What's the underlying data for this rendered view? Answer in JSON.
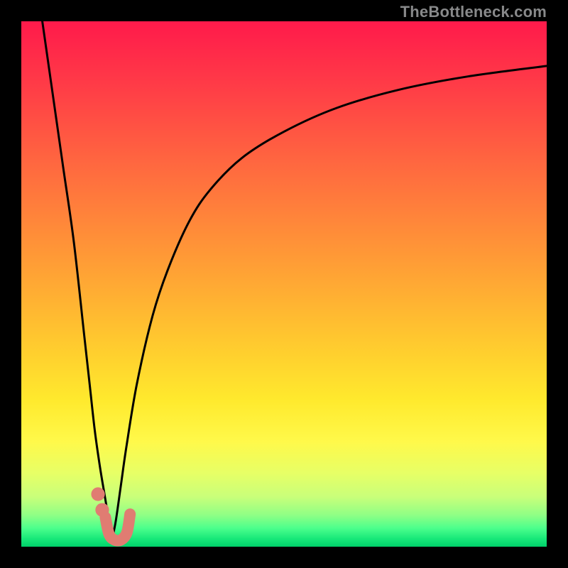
{
  "watermark": "TheBottleneck.com",
  "colors": {
    "black": "#000000",
    "curve": "#000000",
    "marker_fill": "#e07c72",
    "gradient_stops": [
      {
        "offset": 0.0,
        "color": "#ff1a4b"
      },
      {
        "offset": 0.12,
        "color": "#ff3b47"
      },
      {
        "offset": 0.28,
        "color": "#ff6a3f"
      },
      {
        "offset": 0.45,
        "color": "#ff9a36"
      },
      {
        "offset": 0.6,
        "color": "#ffc62f"
      },
      {
        "offset": 0.72,
        "color": "#ffe92d"
      },
      {
        "offset": 0.8,
        "color": "#fff94a"
      },
      {
        "offset": 0.86,
        "color": "#e7ff66"
      },
      {
        "offset": 0.905,
        "color": "#c9ff7a"
      },
      {
        "offset": 0.94,
        "color": "#8fff85"
      },
      {
        "offset": 0.965,
        "color": "#4bff8c"
      },
      {
        "offset": 0.985,
        "color": "#17e879"
      },
      {
        "offset": 1.0,
        "color": "#00d06a"
      }
    ]
  },
  "chart_data": {
    "type": "line",
    "title": "",
    "xlabel": "",
    "ylabel": "",
    "xlim": [
      0,
      100
    ],
    "ylim": [
      0,
      100
    ],
    "note": "Two curves converging near x≈17 forming a V; right curve rises asymptotically. Values are estimated from pixels (y: 0 bottom → 100 top).",
    "series": [
      {
        "name": "left-branch",
        "x": [
          4,
          6,
          8,
          10,
          12,
          13,
          14,
          15,
          16,
          16.8,
          17.3
        ],
        "y": [
          100,
          86,
          72,
          58,
          40,
          31,
          22,
          15,
          9,
          4,
          1.5
        ]
      },
      {
        "name": "right-branch",
        "x": [
          17.3,
          18,
          19,
          20,
          22,
          25,
          28,
          32,
          36,
          42,
          50,
          60,
          72,
          85,
          100
        ],
        "y": [
          1.5,
          5,
          12,
          19,
          31,
          44,
          53,
          62,
          68,
          74,
          79,
          83.5,
          87,
          89.5,
          91.5
        ]
      }
    ],
    "markers": [
      {
        "name": "dot-upper",
        "x": 14.6,
        "y": 10.0,
        "r": 1.3
      },
      {
        "name": "dot-lower",
        "x": 15.4,
        "y": 7.0,
        "r": 1.3
      },
      {
        "name": "hook",
        "shape": "path",
        "desc": "thick J-shaped marker at valley",
        "path_xy": [
          [
            16.0,
            5.6
          ],
          [
            16.7,
            2.4
          ],
          [
            17.7,
            1.3
          ],
          [
            19.0,
            1.3
          ],
          [
            20.1,
            2.7
          ],
          [
            20.7,
            6.2
          ]
        ]
      }
    ]
  }
}
